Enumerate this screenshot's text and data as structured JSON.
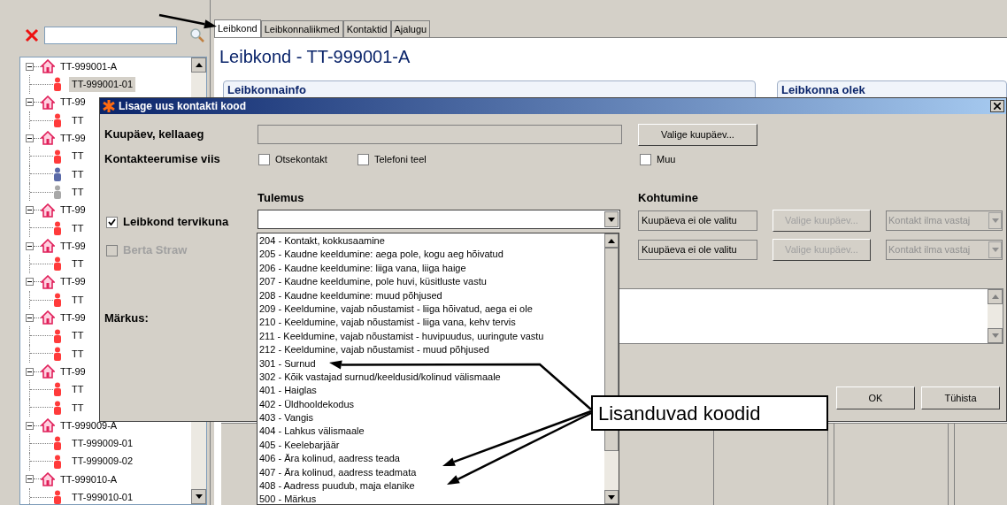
{
  "sidebar": {
    "tree": [
      {
        "label": "TT-999001-A",
        "expanded": true,
        "selected": false,
        "children": [
          {
            "label": "TT-999001-01",
            "selected": true,
            "color": "#ff3b3b"
          }
        ]
      },
      {
        "label": "TT-99",
        "expanded": true,
        "selected": false,
        "children": [
          {
            "label": "TT",
            "selected": false,
            "color": "#ff3b3b"
          }
        ]
      },
      {
        "label": "TT-99",
        "expanded": true,
        "selected": false,
        "children": [
          {
            "label": "TT",
            "selected": false,
            "color": "#ff3b3b"
          },
          {
            "label": "TT",
            "selected": false,
            "color": "#5a6aa8"
          },
          {
            "label": "TT",
            "selected": false,
            "color": "#a8a8a8"
          }
        ]
      },
      {
        "label": "TT-99",
        "expanded": true,
        "selected": false,
        "children": [
          {
            "label": "TT",
            "selected": false,
            "color": "#ff3b3b"
          }
        ]
      },
      {
        "label": "TT-99",
        "expanded": true,
        "selected": false,
        "children": [
          {
            "label": "TT",
            "selected": false,
            "color": "#ff3b3b"
          }
        ]
      },
      {
        "label": "TT-99",
        "expanded": true,
        "selected": false,
        "children": [
          {
            "label": "TT",
            "selected": false,
            "color": "#ff3b3b"
          }
        ]
      },
      {
        "label": "TT-99",
        "expanded": true,
        "selected": false,
        "children": [
          {
            "label": "TT",
            "selected": false,
            "color": "#ff3b3b"
          },
          {
            "label": "TT",
            "selected": false,
            "color": "#ff3b3b"
          }
        ]
      },
      {
        "label": "TT-99",
        "expanded": true,
        "selected": false,
        "children": [
          {
            "label": "TT",
            "selected": false,
            "color": "#ff3b3b"
          },
          {
            "label": "TT",
            "selected": false,
            "color": "#ff3b3b"
          }
        ]
      },
      {
        "label": "TT-999009-A",
        "expanded": true,
        "selected": false,
        "children": [
          {
            "label": "TT-999009-01",
            "selected": false,
            "color": "#ff3b3b"
          },
          {
            "label": "TT-999009-02",
            "selected": false,
            "color": "#ff3b3b"
          }
        ]
      },
      {
        "label": "TT-999010-A",
        "expanded": true,
        "selected": false,
        "children": [
          {
            "label": "TT-999010-01",
            "selected": false,
            "color": "#ff3b3b"
          }
        ]
      }
    ]
  },
  "main": {
    "tabs": [
      {
        "label": "Leibkond",
        "selected": true
      },
      {
        "label": "Leibkonnaliikmed",
        "selected": false
      },
      {
        "label": "Kontaktid",
        "selected": false
      },
      {
        "label": "Ajalugu",
        "selected": false
      }
    ],
    "title": "Leibkond - TT-999001-A",
    "groups": [
      "Leibkonnainfo",
      "Leibkonna olek"
    ]
  },
  "dialog": {
    "title": "Lisage uus kontakti kood",
    "date_label": "Kuupäev, kellaaeg",
    "date_field": {
      "disabled": true
    },
    "date_button": "Valige kuupäev...",
    "method_label": "Kontakteerumise viis",
    "methods": [
      {
        "label": "Otsekontakt",
        "checked": false
      },
      {
        "label": "Telefoni teel",
        "checked": false
      },
      {
        "label": "Muu",
        "checked": false
      }
    ],
    "result_heading": "Tulemus",
    "meeting_heading": "Kohtumine",
    "targets": [
      {
        "label": "Leibkond tervikuna",
        "checked": true,
        "disabled": false
      },
      {
        "label": "Berta Straw",
        "checked": false,
        "disabled": true
      }
    ],
    "meetings": [
      {
        "date": "Kuupäeva ei ole valitu",
        "button": "Valige kuupäev...",
        "type": "Kontakt ilma vastaj",
        "disabled": true
      },
      {
        "date": "Kuupäeva ei ole valitu",
        "button": "Valige kuupäev...",
        "type": "Kontakt ilma vastaj",
        "disabled": true
      }
    ],
    "note_label": "Märkus:",
    "buttons": [
      "OK",
      "Tühista"
    ],
    "result_options": [
      "204 - Kontakt, kokkusaamine",
      "205 - Kaudne keeldumine: aega pole, kogu aeg hõivatud",
      "206 - Kaudne keeldumine: liiga vana, liiga haige",
      "207 - Kaudne keeldumine, pole huvi, küsitluste vastu",
      "208 - Kaudne keeldumine: muud põhjused",
      "209 - Keeldumine, vajab nõustamist - liiga hõivatud, aega ei ole",
      "210 - Keeldumine, vajab nõustamist - liiga vana, kehv tervis",
      "211 - Keeldumine, vajab nõustamist - huvipuudus, uuringute vastu",
      "212 - Keeldumine, vajab nõustamist - muud põhjused",
      "301 - Surnud",
      "302 - Kõik vastajad surnud/keeldusid/kolinud välismaale",
      "401 - Haiglas",
      "402 - Üldhooldekodus",
      "403 - Vangis",
      "404 - Lahkus välismaale",
      "405 - Keelebarjäär",
      "406 - Ära kolinud, aadress teada",
      "407 - Ära kolinud, aadress teadmata",
      "408 - Aadress puudub, maja elanike",
      "500 - Märkus"
    ]
  },
  "annotation": {
    "text": "Lisanduvad koodid"
  }
}
